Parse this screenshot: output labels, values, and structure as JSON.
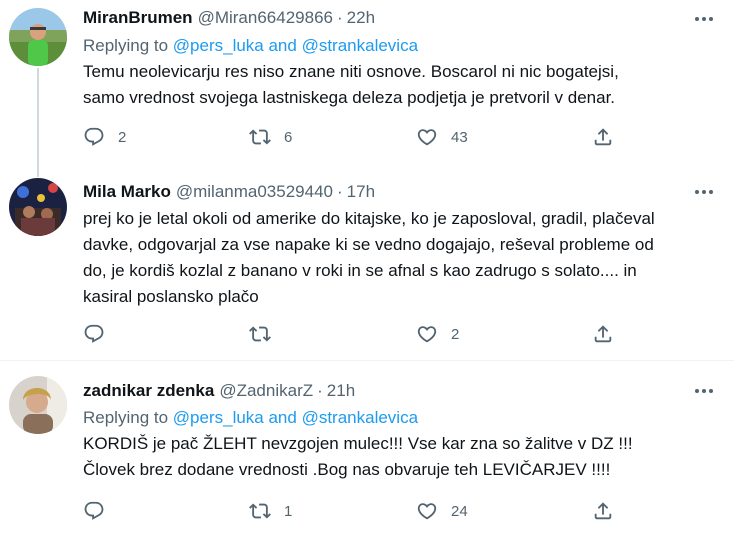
{
  "tweets": [
    {
      "name": "MiranBrumen",
      "handle": "@Miran66429866",
      "sep": "·",
      "time": "22h",
      "replying_label": "Replying to ",
      "mention1": "@pers_luka",
      "and": " and ",
      "mention2": "@strankalevica",
      "lines": [
        "Temu neolevicarju res niso znane niti osnove. Boscarol ni nic bogatejsi,",
        "samo vrednost svojega lastniskega deleza podjetja je pretvoril v denar."
      ],
      "replies": "2",
      "retweets": "6",
      "likes": "43"
    },
    {
      "name": "Mila Marko",
      "handle": "@milanma03529440",
      "sep": "·",
      "time": "17h",
      "lines": [
        "prej ko je letal okoli od amerike do kitajske, ko je zaposloval, gradil, plačeval",
        "davke, odgovarjal za vse napake ki se vedno dogajajo, reševal probleme od",
        "do, je kordiš kozlal z banano v roki in se afnal s kao zadrugo s solato.... in",
        "kasiral poslansko plačo"
      ],
      "replies": "",
      "retweets": "",
      "likes": "2"
    },
    {
      "name": "zadnikar zdenka",
      "handle": "@ZadnikarZ",
      "sep": "·",
      "time": "21h",
      "replying_label": "Replying to ",
      "mention1": "@pers_luka",
      "and": " and ",
      "mention2": "@strankalevica",
      "lines": [
        "KORDIŠ je pač ŽLEHT nevzgojen mulec!!! Vse kar zna so žalitve v DZ !!!",
        "Človek brez dodane vrednosti .Bog nas obvaruje teh LEVIČARJEV !!!!"
      ],
      "replies": "",
      "retweets": "1",
      "likes": "24"
    }
  ],
  "colors": {
    "text": "#0f1419",
    "secondary": "#536471",
    "link": "#1d9bf0",
    "thread_line": "#cfd9de",
    "divider": "#eff3f4"
  },
  "icons": {
    "reply": "reply-icon",
    "retweet": "retweet-icon",
    "like": "like-icon",
    "share": "share-icon",
    "more": "more-icon"
  }
}
